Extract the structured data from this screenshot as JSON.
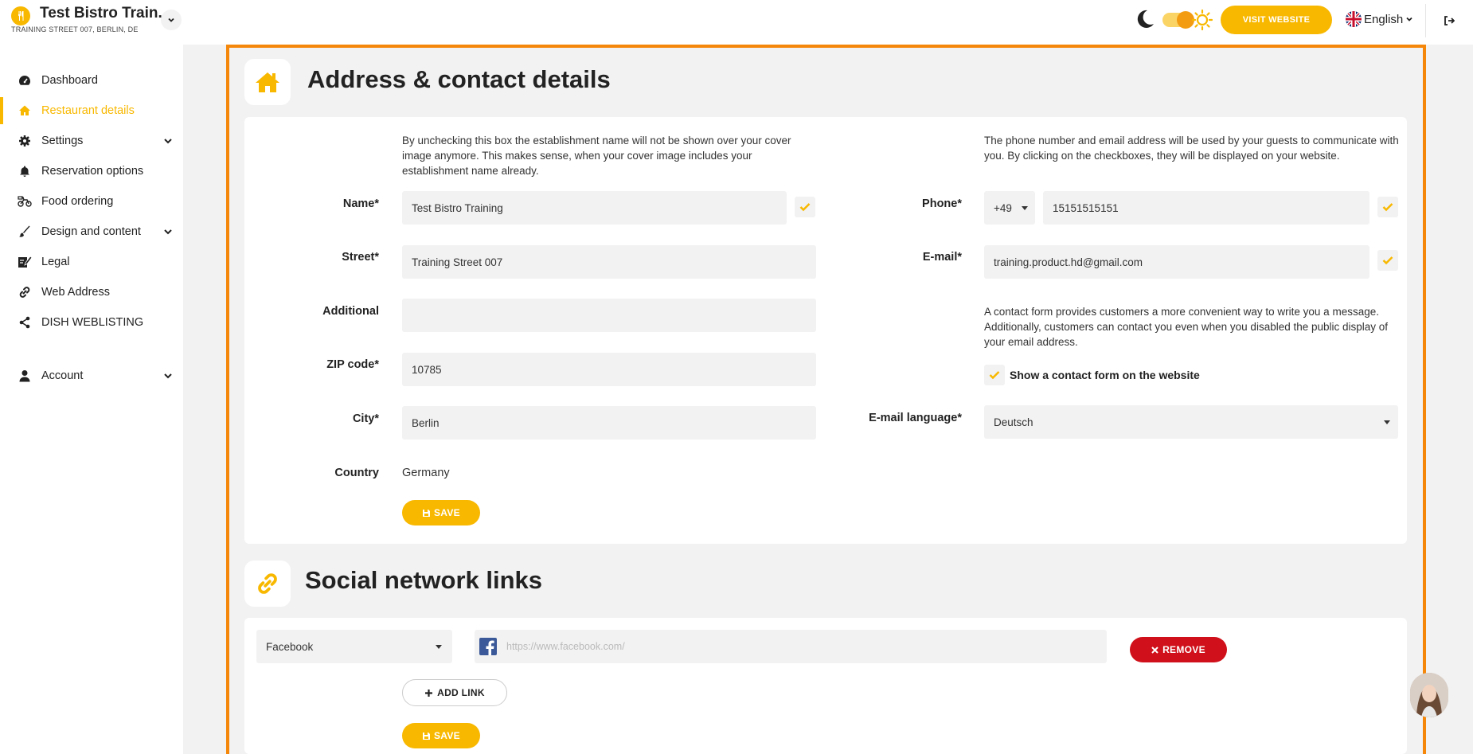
{
  "header": {
    "business_name": "Test Bistro Train..",
    "business_address": "TRAINING STREET 007, BERLIN, DE",
    "visit_website_label": "VISIT WEBSITE",
    "language": "English"
  },
  "sidebar": {
    "items": [
      {
        "label": "Dashboard",
        "icon": "dashboard-icon"
      },
      {
        "label": "Restaurant details",
        "icon": "home-icon",
        "active": true
      },
      {
        "label": "Settings",
        "icon": "gear-icon",
        "expandable": true
      },
      {
        "label": "Reservation options",
        "icon": "bell-icon"
      },
      {
        "label": "Food ordering",
        "icon": "bike-icon"
      },
      {
        "label": "Design and content",
        "icon": "brush-icon",
        "expandable": true
      },
      {
        "label": "Legal",
        "icon": "legal-icon"
      },
      {
        "label": "Web Address",
        "icon": "link-icon"
      },
      {
        "label": "DISH WEBLISTING",
        "icon": "share-icon"
      },
      {
        "label": "Account",
        "icon": "user-icon",
        "expandable": true
      }
    ]
  },
  "address_section": {
    "title": "Address & contact details",
    "name_help": "By unchecking this box the establishment name will not be shown over your cover image anymore. This makes sense, when your cover image includes your establishment name already.",
    "contact_help": "The phone number and email address will be used by your guests to communicate with you. By clicking on the checkboxes, they will be displayed on your website.",
    "form_help": "A contact form provides customers a more convenient way to write you a message. Additionally, customers can contact you even when you disabled the public display of your email address.",
    "fields": {
      "name": {
        "label": "Name*",
        "value": "Test Bistro Training",
        "checked": true
      },
      "street": {
        "label": "Street*",
        "value": "Training Street 007"
      },
      "additional": {
        "label": "Additional",
        "value": ""
      },
      "zip": {
        "label": "ZIP code*",
        "value": "10785"
      },
      "city": {
        "label": "City*",
        "value": "Berlin"
      },
      "country": {
        "label": "Country",
        "value": "Germany"
      },
      "phone": {
        "label": "Phone*",
        "prefix": "+49",
        "value": "15151515151",
        "checked": true
      },
      "email": {
        "label": "E-mail*",
        "value": "training.product.hd@gmail.com",
        "checked": true
      },
      "contact_form": {
        "label": "Show a contact form on the website",
        "checked": true
      },
      "email_language": {
        "label": "E-mail language*",
        "value": "Deutsch"
      }
    },
    "save_label": "SAVE"
  },
  "social_section": {
    "title": "Social network links",
    "network": "Facebook",
    "url_placeholder": "https://www.facebook.com/",
    "remove_label": "REMOVE",
    "add_link_label": "ADD LINK",
    "save_label": "SAVE"
  },
  "colors": {
    "accent": "#f8b800",
    "frame": "#f5870a",
    "danger": "#d0101a"
  }
}
